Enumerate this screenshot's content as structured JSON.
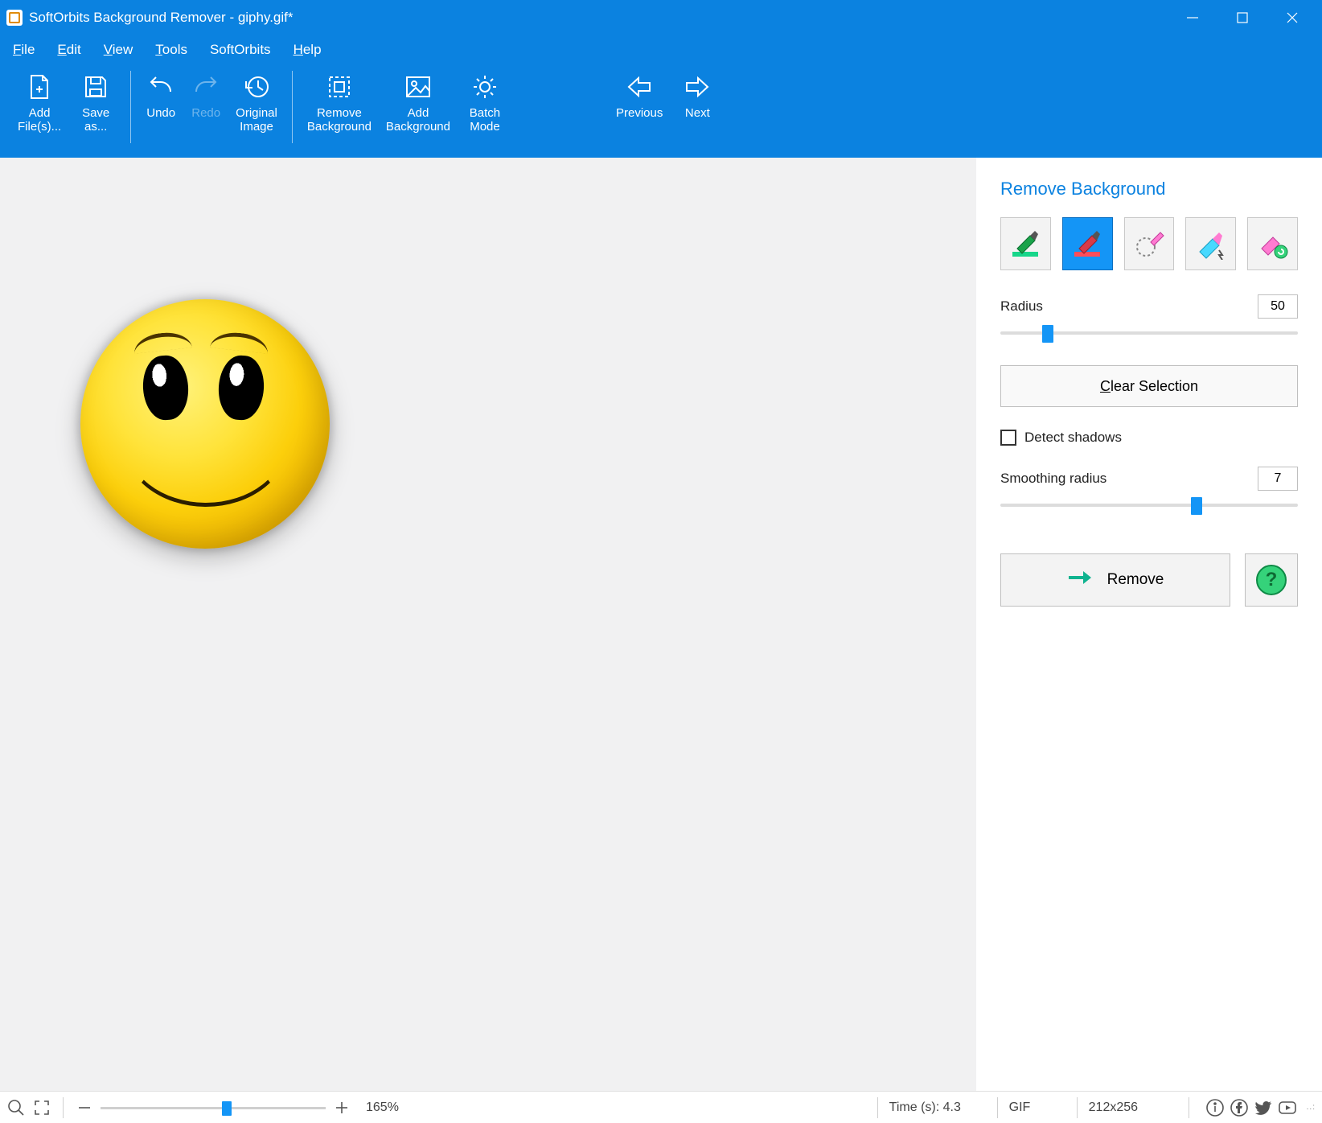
{
  "titlebar": {
    "app_name": "SoftOrbits Background Remover",
    "document": "giphy.gif*"
  },
  "menu": {
    "file": {
      "prefix": "",
      "u": "F",
      "rest": "ile"
    },
    "edit": {
      "prefix": "",
      "u": "E",
      "rest": "dit"
    },
    "view": {
      "prefix": "",
      "u": "V",
      "rest": "iew"
    },
    "tools": {
      "prefix": "",
      "u": "T",
      "rest": "ools"
    },
    "softorbits": {
      "prefix": "",
      "u": "",
      "rest": "SoftOrbits"
    },
    "help": {
      "prefix": "",
      "u": "H",
      "rest": "elp"
    }
  },
  "toolbar": {
    "add_files_l1": "Add",
    "add_files_l2": "File(s)...",
    "save_as_l1_pre": "",
    "save_as_l1_u": "S",
    "save_as_l1_post": "ave",
    "save_as_l2": "as...",
    "undo_pre": "",
    "undo_u": "U",
    "undo_post": "ndo",
    "redo_pre": "",
    "redo_u": "R",
    "redo_post": "edo",
    "original_l1": "Original",
    "original_l2": "Image",
    "remove_bg_l1": "Remove",
    "remove_bg_l2": "Background",
    "add_bg_l1": "Add",
    "add_bg_l2": "Background",
    "batch_l1": "Batch",
    "batch_l2": "Mode",
    "previous": "Previous",
    "next": "Next"
  },
  "panel": {
    "title": "Remove Background",
    "radius_label": "Radius",
    "radius_value": "50",
    "radius_percent": 16,
    "clear_pre": "",
    "clear_u": "C",
    "clear_post": "lear Selection",
    "detect_shadows": "Detect shadows",
    "detect_shadows_checked": false,
    "smoothing_label": "Smoothing radius",
    "smoothing_value": "7",
    "smoothing_percent": 66,
    "remove_pre": "Remo",
    "remove_u": "v",
    "remove_post": "e",
    "tools": [
      {
        "name": "mark-keep-tool",
        "selected": false
      },
      {
        "name": "mark-remove-tool",
        "selected": true
      },
      {
        "name": "lasso-erase-tool",
        "selected": false
      },
      {
        "name": "auto-erase-tool",
        "selected": false
      },
      {
        "name": "refresh-tool",
        "selected": false
      }
    ]
  },
  "status": {
    "zoom_percent": "165%",
    "zoom_slider_percent": 56,
    "time_label": "Time (s): 4.3",
    "format": "GIF",
    "dimensions": "212x256"
  }
}
